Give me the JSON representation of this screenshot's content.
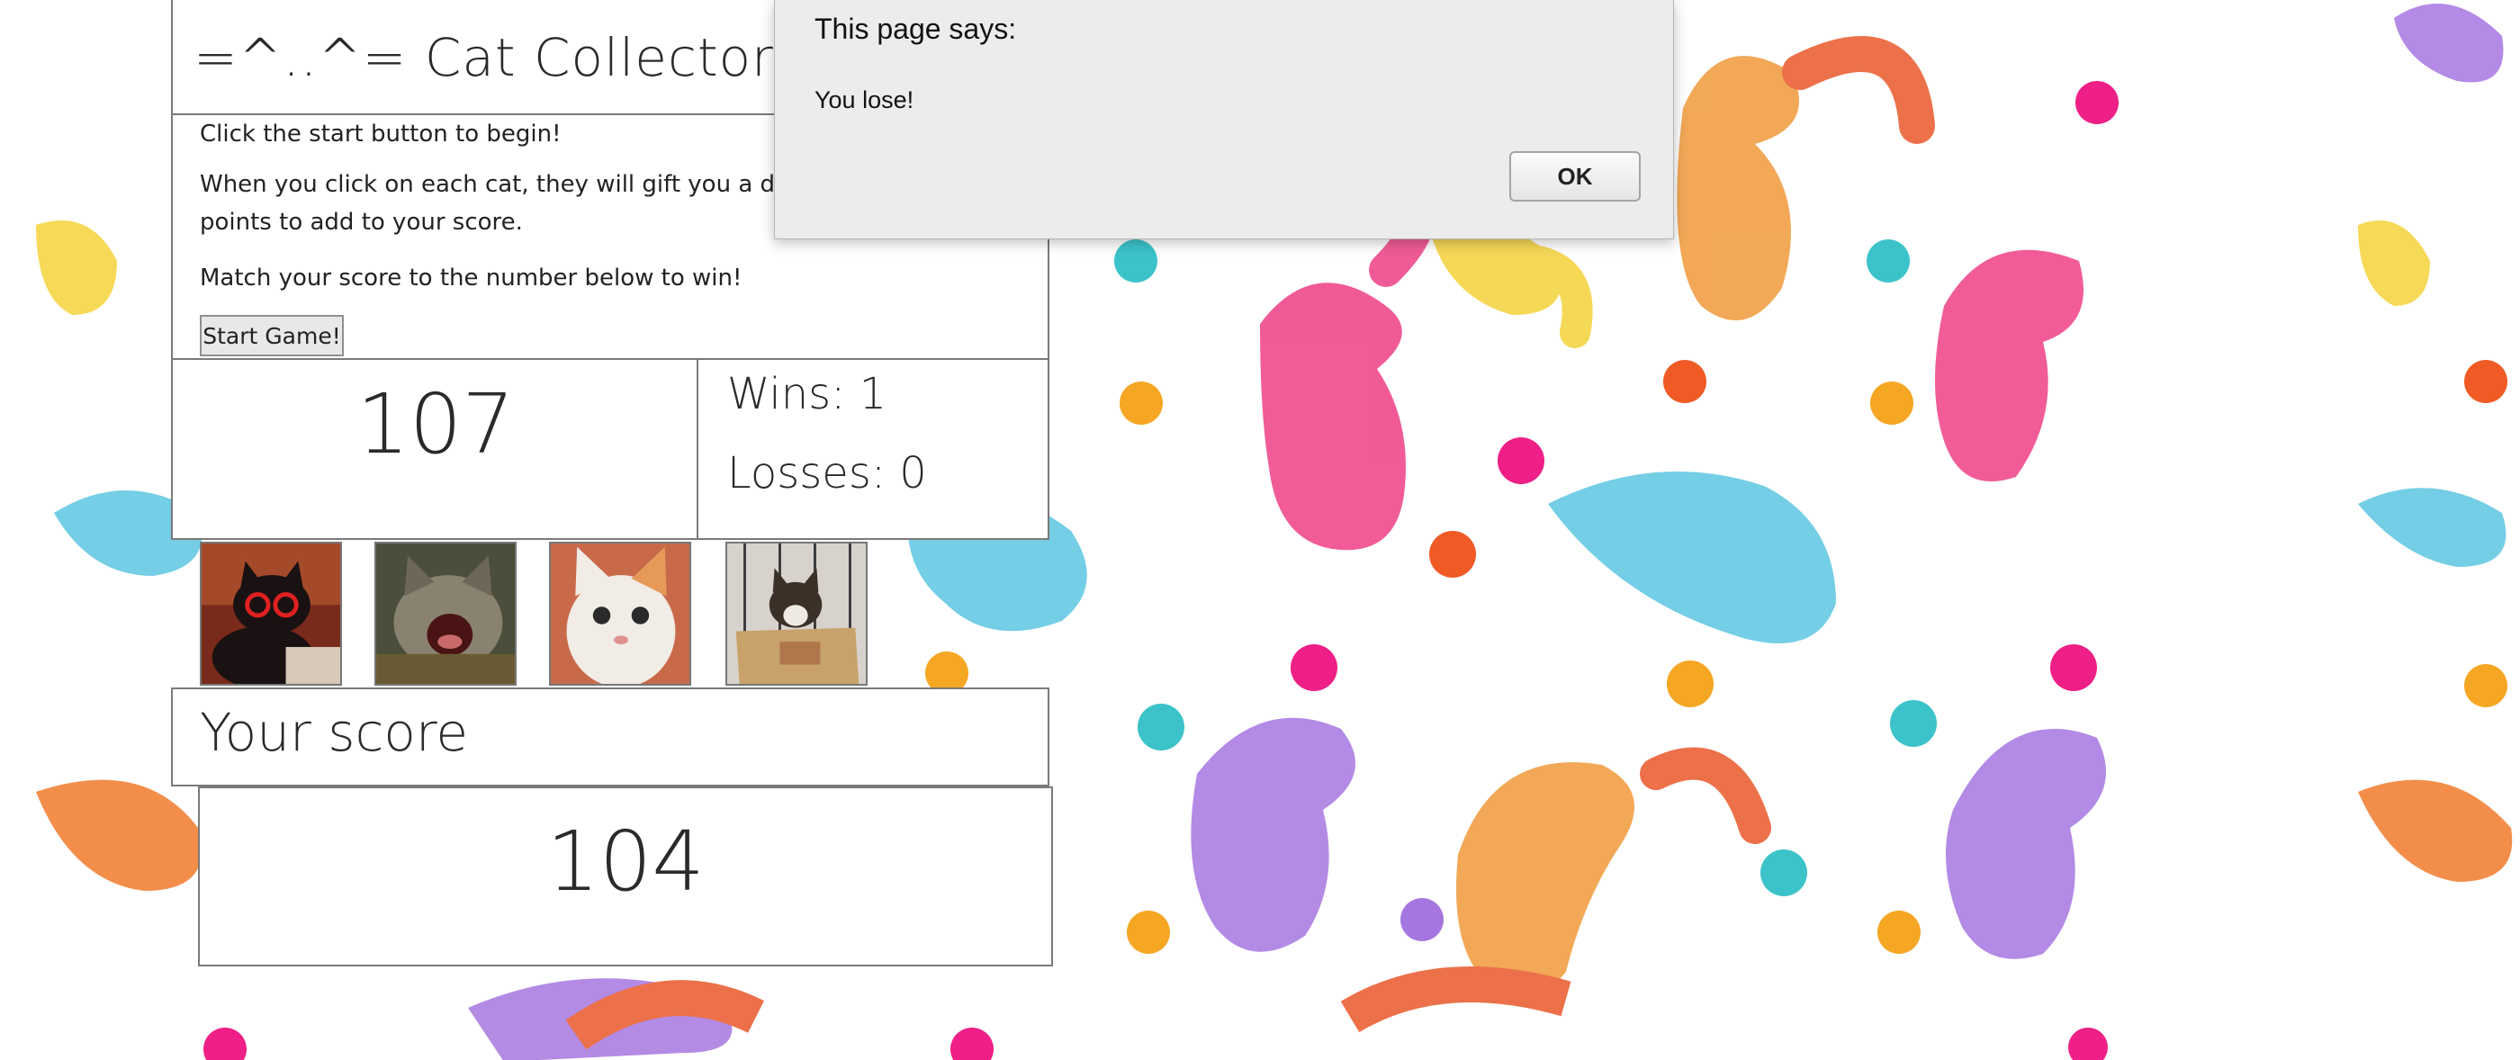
{
  "game": {
    "title": "=^..^= Cat Collector! =^..^=",
    "instructions": [
      "Click the start button to begin!",
      "When you click on each cat, they will gift you a different amount of points to add to your score.",
      "Match your score to the number below to win!"
    ],
    "start_button": "Start Game!",
    "target_number": "107",
    "wins": "Wins: 1",
    "losses": "Losses: 0",
    "cats": [
      {
        "icon": "cat-photo-red-glasses"
      },
      {
        "icon": "cat-photo-yawning-tabby"
      },
      {
        "icon": "cat-photo-white-orange"
      },
      {
        "icon": "cat-photo-in-box"
      }
    ],
    "score_label": "Your score",
    "score": "104"
  },
  "dialog": {
    "title": "This page says:",
    "message": "You lose!",
    "ok_label": "OK"
  },
  "colors": {
    "background_cats": [
      "#f07a2a",
      "#ee3f86",
      "#5cc6e0",
      "#a676e0",
      "#f5d23a",
      "#f09a3a"
    ]
  }
}
